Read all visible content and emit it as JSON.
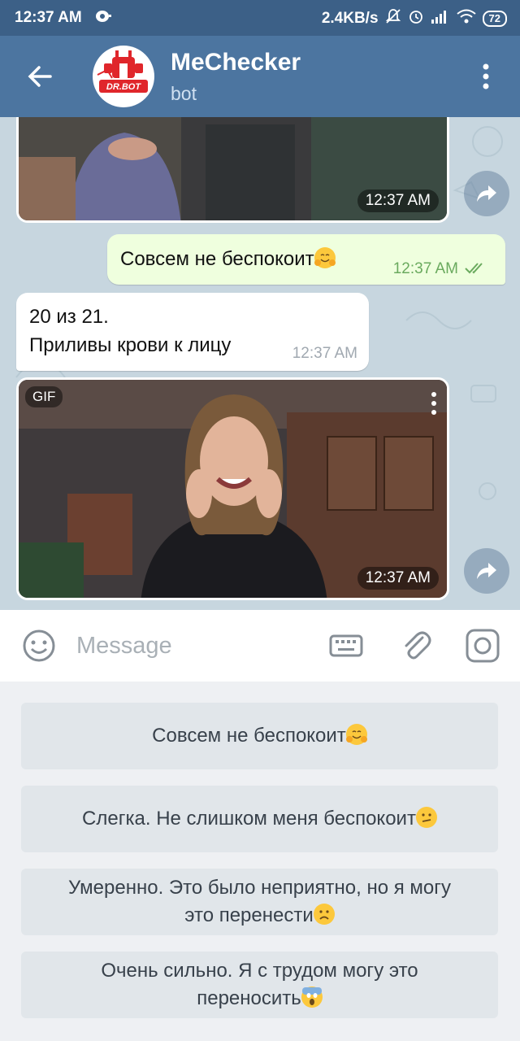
{
  "status_bar": {
    "time": "12:37 AM",
    "speed": "2.4KB/s",
    "battery": "72"
  },
  "header": {
    "title": "MeChecker",
    "subtitle": "bot",
    "avatar_label": "DR.BOT"
  },
  "messages": {
    "media1_time": "12:37 AM",
    "outgoing": {
      "text": "Совсем не беспокоит",
      "emoji": "hugging-face",
      "time": "12:37 AM"
    },
    "incoming": {
      "line1": "20 из 21.",
      "line2": "Приливы крови к лицу",
      "time": "12:37 AM"
    },
    "gif": {
      "badge": "GIF",
      "time": "12:37 AM"
    }
  },
  "input": {
    "placeholder": "Message"
  },
  "keyboard": {
    "buttons": [
      {
        "text": "Совсем не беспокоит",
        "emoji": "hugging-face"
      },
      {
        "text": "Слегка. Не слишком меня беспокоит",
        "emoji": "confused-face"
      },
      {
        "line1": "Умеренно. Это было неприятно, но я могу",
        "line2": "это перенести",
        "emoji": "frowning-face"
      },
      {
        "line1": "Очень сильно. Я с трудом могу это",
        "line2": "переносить",
        "emoji": "screaming-face"
      }
    ]
  },
  "colors": {
    "header": "#4c75a0",
    "status_bar": "#3c6087",
    "outgoing_bubble": "#efffde",
    "chat_background": "#c7d6df",
    "keyboard_button": "#e1e6ea"
  }
}
